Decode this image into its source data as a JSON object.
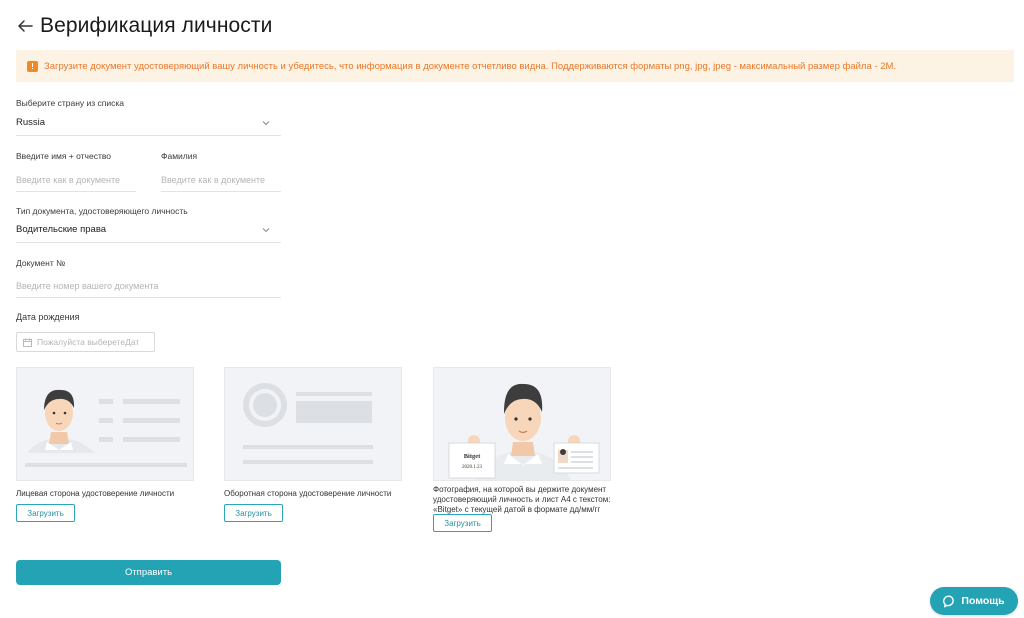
{
  "header": {
    "title": "Верификация личности"
  },
  "notice": {
    "text": "Загрузите документ удостоверяющий вашу личность и убедитесь, что информация в документе отчетливо видна. Поддерживаются форматы png, jpg, jpeg - максимальный размер файла - 2M."
  },
  "form": {
    "country": {
      "label": "Выберите страну из списка",
      "value": "Russia"
    },
    "first_name": {
      "label": "Введите имя + отчество",
      "placeholder": "Введите как в документе"
    },
    "last_name": {
      "label": "Фамилия",
      "placeholder": "Введите как в документе"
    },
    "doc_type": {
      "label": "Тип документа, удостоверяющего личность",
      "value": "Водительские права"
    },
    "doc_number": {
      "label": "Документ №",
      "placeholder": "Введите номер вашего документа"
    },
    "birth_date": {
      "label": "Дата рождения",
      "placeholder": "Пожалуйста выберетеДат"
    }
  },
  "uploads": [
    {
      "caption": "Лицевая сторона удостоверение личности",
      "button": "Загрузить"
    },
    {
      "caption": "Оборотная сторона удостоверение личности",
      "button": "Загрузить"
    },
    {
      "caption": "Фотография, на которой вы держите документ удостоверяющий личность и лист А4 с текстом: «Bitget» с текущей датой в формате дд/мм/гг",
      "button": "Загрузить",
      "sign_title": "Bitget",
      "sign_date": "2020.1.23"
    }
  ],
  "submit_label": "Отправить",
  "help_label": "Помощь",
  "colors": {
    "accent": "#24a3b4",
    "notice_bg": "#fdf3e4",
    "notice_text": "#e8782a"
  },
  "icons": {
    "back": "arrow-left-icon",
    "notice": "warning-icon",
    "select": "chevron-down-icon",
    "date": "calendar-icon",
    "help": "chat-bubble-icon"
  }
}
